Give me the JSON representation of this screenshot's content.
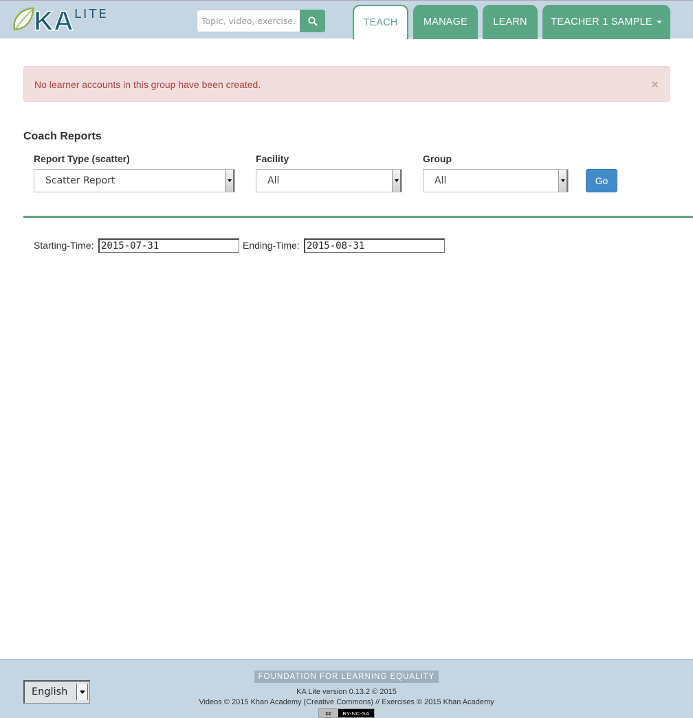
{
  "header": {
    "logo": {
      "ka": "KA",
      "lite": "LITE"
    },
    "search": {
      "placeholder": "Topic, video, exercise..."
    },
    "tabs": [
      {
        "label": "TEACH",
        "active": true
      },
      {
        "label": "MANAGE",
        "active": false
      },
      {
        "label": "LEARN",
        "active": false
      },
      {
        "label": "TEACHER 1 SAMPLE",
        "active": false,
        "dropdown": true
      }
    ]
  },
  "alert": {
    "text": "No learner accounts in this group have been created.",
    "close": "×"
  },
  "report": {
    "title": "Coach Reports",
    "report_type": {
      "label": "Report Type (scatter)",
      "value": "Scatter Report"
    },
    "facility": {
      "label": "Facility",
      "value": "All"
    },
    "group": {
      "label": "Group",
      "value": "All"
    },
    "go_label": "Go",
    "starting_time": {
      "label": "Starting-Time:",
      "value": "2015-07-31"
    },
    "ending_time": {
      "label": "Ending-Time:",
      "value": "2015-08-31"
    }
  },
  "footer": {
    "language": "English",
    "banner": "FOUNDATION FOR LEARNING EQUALITY",
    "version": "KA Lite version 0.13.2 © 2015",
    "credits": "Videos © 2015 Khan Academy (Creative Commons) // Exercises © 2015 Khan Academy",
    "license_left": "cc",
    "license_right": "BY-NC-SA"
  },
  "colors": {
    "accent": "#5aa685",
    "header_bg": "#c5d6e2",
    "alert_bg": "#f2dede",
    "alert_text": "#a94442",
    "primary_button": "#428bca"
  },
  "icons": [
    "leaf-logo-icon",
    "search-icon",
    "caret-down-icon",
    "close-icon",
    "select-arrow-icon",
    "creative-commons-icon"
  ]
}
